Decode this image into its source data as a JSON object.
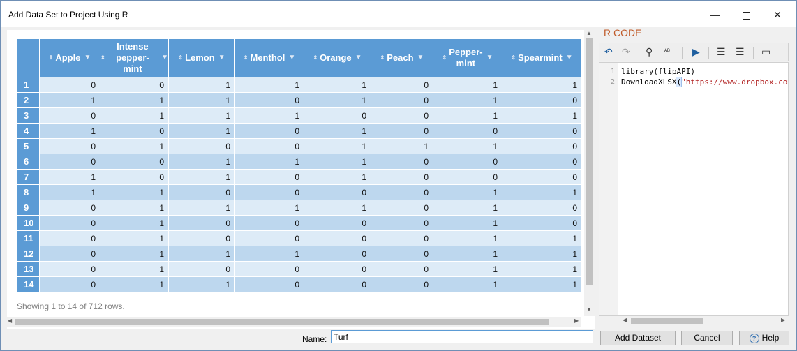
{
  "window": {
    "title": "Add Data Set to Project Using R",
    "minimize": "—",
    "close": "✕"
  },
  "grid": {
    "columns": [
      "Apple",
      "Intense pepper-\nmint",
      "Lemon",
      "Menthol",
      "Orange",
      "Peach",
      "Pepper-\nmint",
      "Spearmint"
    ],
    "rows": [
      {
        "n": "1",
        "v": [
          "0",
          "0",
          "1",
          "1",
          "1",
          "0",
          "1",
          "1"
        ]
      },
      {
        "n": "2",
        "v": [
          "1",
          "1",
          "1",
          "0",
          "1",
          "0",
          "1",
          "0"
        ]
      },
      {
        "n": "3",
        "v": [
          "0",
          "1",
          "1",
          "1",
          "0",
          "0",
          "1",
          "1"
        ]
      },
      {
        "n": "4",
        "v": [
          "1",
          "0",
          "1",
          "0",
          "1",
          "0",
          "0",
          "0"
        ]
      },
      {
        "n": "5",
        "v": [
          "0",
          "1",
          "0",
          "0",
          "1",
          "1",
          "1",
          "0"
        ]
      },
      {
        "n": "6",
        "v": [
          "0",
          "0",
          "1",
          "1",
          "1",
          "0",
          "0",
          "0"
        ]
      },
      {
        "n": "7",
        "v": [
          "1",
          "0",
          "1",
          "0",
          "1",
          "0",
          "0",
          "0"
        ]
      },
      {
        "n": "8",
        "v": [
          "1",
          "1",
          "0",
          "0",
          "0",
          "0",
          "1",
          "1"
        ]
      },
      {
        "n": "9",
        "v": [
          "0",
          "1",
          "1",
          "1",
          "1",
          "0",
          "1",
          "0"
        ]
      },
      {
        "n": "10",
        "v": [
          "0",
          "1",
          "0",
          "0",
          "0",
          "0",
          "1",
          "0"
        ]
      },
      {
        "n": "11",
        "v": [
          "0",
          "1",
          "0",
          "0",
          "0",
          "0",
          "1",
          "1"
        ]
      },
      {
        "n": "12",
        "v": [
          "0",
          "1",
          "1",
          "1",
          "0",
          "0",
          "1",
          "1"
        ]
      },
      {
        "n": "13",
        "v": [
          "0",
          "1",
          "0",
          "0",
          "0",
          "0",
          "1",
          "1"
        ]
      },
      {
        "n": "14",
        "v": [
          "0",
          "1",
          "1",
          "0",
          "0",
          "0",
          "1",
          "1"
        ]
      }
    ],
    "footer": "Showing 1 to 14 of 712 rows."
  },
  "name_field": {
    "label": "Name:",
    "value": "Turf"
  },
  "rcode": {
    "label": "R CODE",
    "line_numbers": [
      "1",
      "2"
    ],
    "line1": "library(flipAPI)",
    "line2_prefix": "DownloadXLSX",
    "line2_paren": "(",
    "line2_string": "\"https://www.dropbox.com"
  },
  "buttons": {
    "add_dataset": "Add Dataset",
    "cancel": "Cancel",
    "help": "Help"
  },
  "colors": {
    "header": "#5b9bd5",
    "row_light": "#ddebf7",
    "row_dark": "#bdd7ee",
    "rcode_label": "#c05a28"
  }
}
